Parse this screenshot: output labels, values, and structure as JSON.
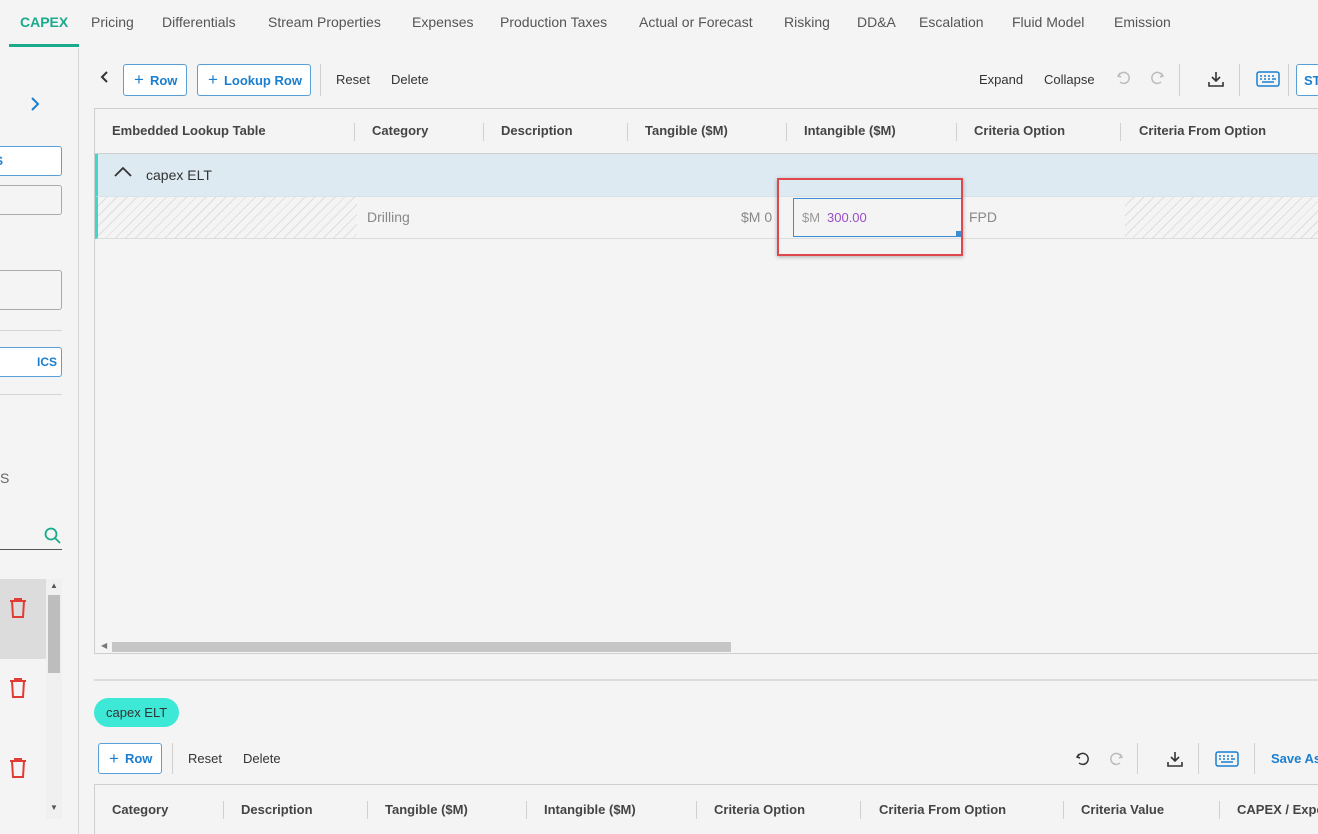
{
  "tabs": [
    {
      "label": "CAPEX",
      "active": true
    },
    {
      "label": "Pricing"
    },
    {
      "label": "Differentials"
    },
    {
      "label": "Stream Properties"
    },
    {
      "label": "Expenses"
    },
    {
      "label": "Production Taxes"
    },
    {
      "label": "Actual or Forecast"
    },
    {
      "label": "Risking"
    },
    {
      "label": "DD&A"
    },
    {
      "label": "Escalation"
    },
    {
      "label": "Fluid Model"
    },
    {
      "label": "Emission"
    }
  ],
  "sidebar": {
    "button1_label": "S",
    "button2_label": "ICS",
    "partial_text": "S",
    "icons": [
      "chevron-right-icon",
      "search-icon",
      "trash-icon"
    ]
  },
  "toolbar": {
    "add_row": "Row",
    "add_lookup_row": "Lookup Row",
    "reset": "Reset",
    "delete": "Delete",
    "expand": "Expand",
    "collapse": "Collapse",
    "partial_button": "ST"
  },
  "grid": {
    "columns": [
      "Embedded Lookup Table",
      "Category",
      "Description",
      "Tangible ($M)",
      "Intangible ($M)",
      "Criteria Option",
      "Criteria From Option"
    ],
    "group_label": "capex ELT",
    "row": {
      "category": "Drilling",
      "tangible": "$M 0",
      "intangible_prefix": "$M",
      "intangible_value": "300.00",
      "criteria_option": "FPD"
    }
  },
  "chip": {
    "label": "capex ELT"
  },
  "toolbar2": {
    "add_row": "Row",
    "reset": "Reset",
    "delete": "Delete",
    "save_as": "Save As"
  },
  "grid2": {
    "columns": [
      "Category",
      "Description",
      "Tangible ($M)",
      "Intangible ($M)",
      "Criteria Option",
      "Criteria From Option",
      "Criteria Value",
      "CAPEX / Expe"
    ]
  },
  "colors": {
    "accent": "#1aaa8c",
    "link": "#1a7fd0",
    "group_row": "#deeaf2",
    "highlight": "#e0474c",
    "chip": "#3ee8d6",
    "edit_value": "#9b4dca"
  }
}
